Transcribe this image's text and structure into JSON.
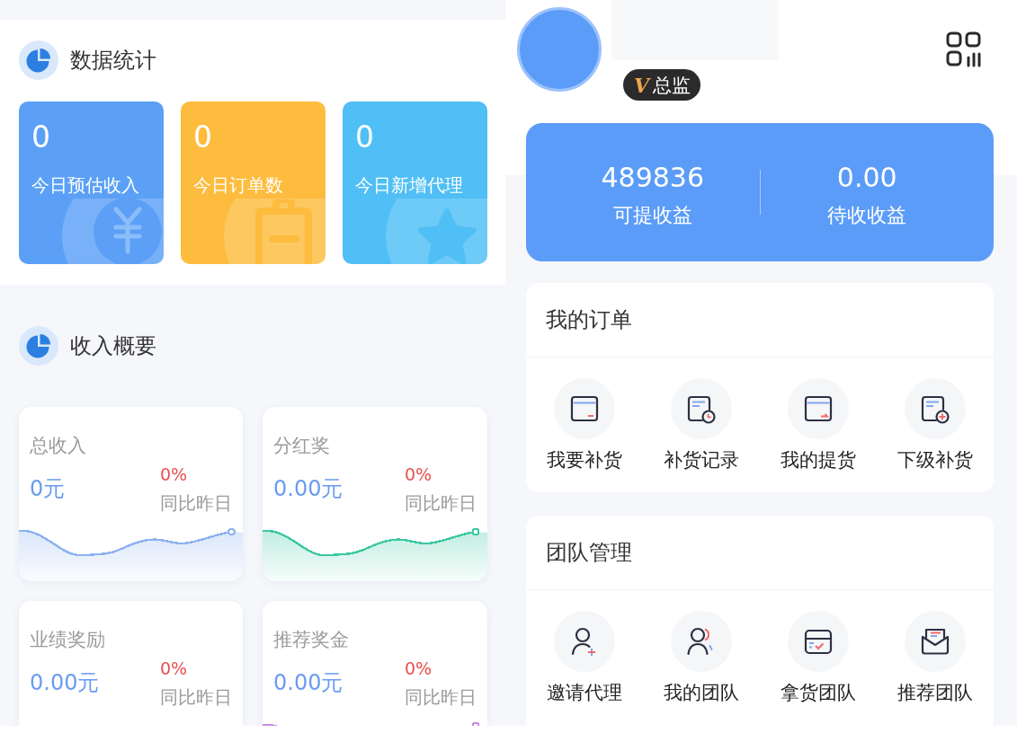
{
  "stats": {
    "title": "数据统计",
    "cards": [
      {
        "value": "0",
        "label": "今日预估收入",
        "kind": "coin",
        "color": "#5ba0f6"
      },
      {
        "value": "0",
        "label": "今日订单数",
        "kind": "clipboard",
        "color": "#fdbc3d"
      },
      {
        "value": "0",
        "label": "今日新增代理",
        "kind": "star",
        "color": "#4fbff5"
      }
    ]
  },
  "income": {
    "title": "收入概要",
    "cards": [
      {
        "title": "总收入",
        "value": "0元",
        "change": "0%",
        "compare": "同比昨日",
        "color": "#8db2f0"
      },
      {
        "title": "分红奖",
        "value": "0.00元",
        "change": "0%",
        "compare": "同比昨日",
        "color": "#3cc8a0"
      },
      {
        "title": "业绩奖励",
        "value": "0.00元",
        "change": "0%",
        "compare": "同比昨日"
      },
      {
        "title": "推荐奖金",
        "value": "0.00元",
        "change": "0%",
        "compare": "同比昨日",
        "color": "#c98ae3"
      }
    ]
  },
  "profile": {
    "badge": {
      "mark": "V",
      "label": "总监"
    }
  },
  "balance": {
    "items": [
      {
        "value": "489836",
        "label": "可提收益"
      },
      {
        "value": "0.00",
        "label": "待收收益"
      }
    ]
  },
  "orders": {
    "title": "我的订单",
    "items": [
      {
        "label": "我要补货",
        "kind": "restock"
      },
      {
        "label": "补货记录",
        "kind": "history"
      },
      {
        "label": "我的提货",
        "kind": "pickup"
      },
      {
        "label": "下级补货",
        "kind": "add"
      }
    ]
  },
  "team": {
    "title": "团队管理",
    "items": [
      {
        "label": "邀请代理",
        "kind": "invite"
      },
      {
        "label": "我的团队",
        "kind": "group"
      },
      {
        "label": "拿货团队",
        "kind": "box"
      },
      {
        "label": "推荐团队",
        "kind": "mail"
      }
    ]
  }
}
